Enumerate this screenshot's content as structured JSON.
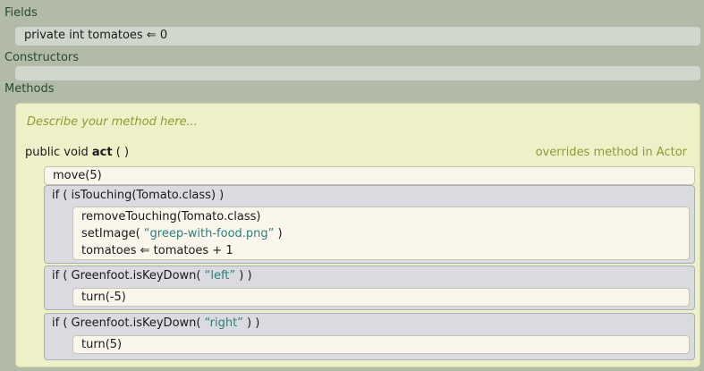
{
  "sections": {
    "fields": "Fields",
    "constructors": "Constructors",
    "methods": "Methods"
  },
  "field": {
    "text": "private int tomatoes ⇐ 0"
  },
  "method": {
    "description": "Describe your method here...",
    "modifiers": "public void",
    "name": "act",
    "parens": "( )",
    "override": "overrides method in Actor"
  },
  "body": {
    "move": "move(5)",
    "if1": {
      "head": "if ( isTouching(Tomato.class) )",
      "line1": "removeTouching(Tomato.class)",
      "line2_prefix": "setImage( ",
      "line2_string": "“greep-with-food.png”",
      "line2_suffix": " )",
      "line3": "tomatoes ⇐ tomatoes + 1"
    },
    "if2": {
      "head_prefix": "if ( Greenfoot.isKeyDown( ",
      "head_string": "“left”",
      "head_suffix": " ) )",
      "line1": "turn(-5)"
    },
    "if3": {
      "head_prefix": "if ( Greenfoot.isKeyDown( ",
      "head_string": "“right”",
      "head_suffix": " ) )",
      "line1": "turn(5)"
    }
  }
}
